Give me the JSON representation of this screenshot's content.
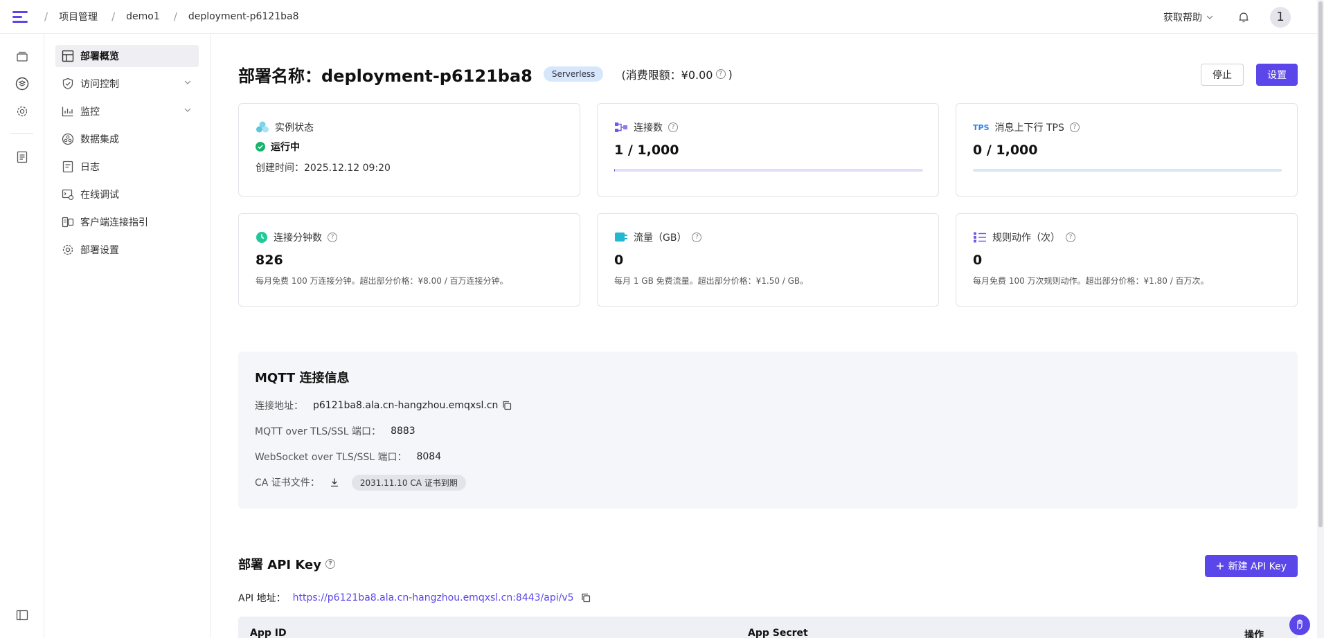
{
  "topbar": {
    "breadcrumbs": [
      "项目管理",
      "demo1",
      "deployment-p6121ba8"
    ],
    "help": "获取帮助",
    "avatar": "1"
  },
  "sidebar": {
    "items": [
      {
        "label": "部署概览",
        "icon": "overview-icon"
      },
      {
        "label": "访问控制",
        "icon": "shield-icon"
      },
      {
        "label": "监控",
        "icon": "chart-icon"
      },
      {
        "label": "数据集成",
        "icon": "integration-icon"
      },
      {
        "label": "日志",
        "icon": "log-icon"
      },
      {
        "label": "在线调试",
        "icon": "debug-icon"
      },
      {
        "label": "客户端连接指引",
        "icon": "client-icon"
      },
      {
        "label": "部署设置",
        "icon": "gear-icon"
      }
    ]
  },
  "header": {
    "title": "部署名称：deployment-p6121ba8",
    "badge": "Serverless",
    "limit": "(消费限额：¥0.00",
    "limit_close": ")",
    "stop_label": "停止",
    "settings_label": "设置"
  },
  "cards": {
    "instance": {
      "title": "实例状态",
      "status": "运行中",
      "created": "创建时间：2025.12.12 09:20"
    },
    "connections": {
      "title": "连接数",
      "value": "1 / 1,000",
      "fill": 0.001
    },
    "tps": {
      "title": "消息上下行 TPS",
      "tag": "TPS",
      "value": "0 / 1,000",
      "fill": 0
    },
    "minutes": {
      "title": "连接分钟数",
      "value": "826",
      "note": "每月免费 100 万连接分钟。超出部分价格：¥8.00 / 百万连接分钟。"
    },
    "traffic": {
      "title": "流量（GB）",
      "value": "0",
      "note": "每月 1 GB 免费流量。超出部分价格：¥1.50 / GB。"
    },
    "rules": {
      "title": "规则动作（次）",
      "value": "0",
      "note": "每月免费 100 万次规则动作。超出部分价格：¥1.80 / 百万次。"
    }
  },
  "mqtt": {
    "title": "MQTT 连接信息",
    "address_label": "连接地址：",
    "address": "p6121ba8.ala.cn-hangzhou.emqxsl.cn",
    "tls_label": "MQTT over TLS/SSL 端口：",
    "tls_port": "8883",
    "ws_label": "WebSocket over TLS/SSL 端口：",
    "ws_port": "8084",
    "ca_label": "CA 证书文件：",
    "ca_expiry": "2031.11.10 CA 证书到期"
  },
  "api": {
    "title": "部署 API Key",
    "new_label": "新建 API Key",
    "address_label": "API 地址：",
    "address": "https://p6121ba8.ala.cn-hangzhou.emqxsl.cn:8443/api/v5",
    "columns": [
      "App ID",
      "App Secret",
      "操作"
    ]
  },
  "colors": {
    "accent": "#5b46ea",
    "success": "#19b36b",
    "badge_bg": "#d6e7fb"
  }
}
